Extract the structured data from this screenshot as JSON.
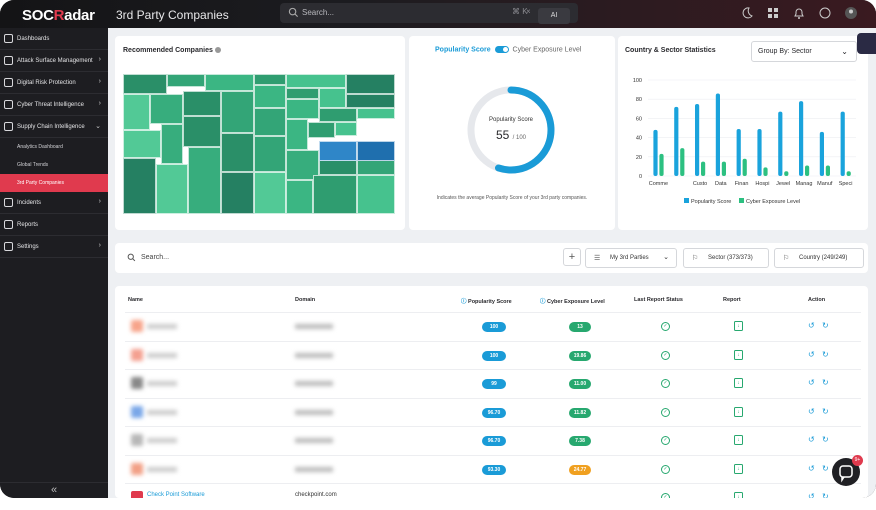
{
  "app": {
    "logo": "SOCRadar",
    "title": "3rd Party Companies"
  },
  "search": {
    "placeholder": "Search...",
    "shortcut": "⌘ K",
    "ai_label": "AI"
  },
  "sidebar": {
    "items": [
      {
        "label": "Dashboards",
        "icon": "dashboard-icon",
        "expandable": false
      },
      {
        "label": "Attack Surface Management",
        "icon": "target-icon",
        "expandable": true
      },
      {
        "label": "Digital Risk Protection",
        "icon": "shield-icon",
        "expandable": true
      },
      {
        "label": "Cyber Threat Intelligence",
        "icon": "radar-icon",
        "expandable": true
      },
      {
        "label": "Supply Chain Intelligence",
        "icon": "chain-icon",
        "expandable": true,
        "expanded": true
      }
    ],
    "subitems": [
      {
        "label": "Analytics Dashboard"
      },
      {
        "label": "Global Trends"
      },
      {
        "label": "3rd Party Companies",
        "active": true
      }
    ],
    "items_after": [
      {
        "label": "Incidents",
        "icon": "alert-icon",
        "expandable": true
      },
      {
        "label": "Reports",
        "icon": "report-icon",
        "expandable": false
      },
      {
        "label": "Settings",
        "icon": "settings-icon",
        "expandable": true
      }
    ],
    "collapse_label": "«"
  },
  "recommended": {
    "title": "Recommended Companies"
  },
  "popularity": {
    "toggle_left": "Popularity Score",
    "toggle_right": "Cyber Exposure Level",
    "label": "Popularity Score",
    "value": "55",
    "max": "/ 100",
    "fraction": 0.55,
    "description": "Indicates the average Popularity Score of your 3rd party companies."
  },
  "stats": {
    "title": "Country & Sector Statistics",
    "group_by": "Group By: Sector"
  },
  "chart_data": {
    "type": "bar",
    "categories": [
      "Comme",
      "",
      "Custo",
      "Data",
      "Finan",
      "Hospi",
      "Jewel",
      "Manag",
      "Manuf",
      "Speci"
    ],
    "series": [
      {
        "name": "Popularity Score",
        "color": "#1aa3dc",
        "values": [
          48,
          72,
          75,
          86,
          49,
          49,
          67,
          78,
          46,
          67
        ]
      },
      {
        "name": "Cyber Exposure Level",
        "color": "#2cc081",
        "values": [
          23,
          29,
          15,
          15,
          18,
          9,
          5,
          11,
          11,
          5
        ]
      }
    ],
    "ylim": [
      0,
      100
    ],
    "yticks": [
      "0",
      "20",
      "40",
      "60",
      "80",
      "100"
    ],
    "legend": "bottom"
  },
  "filters": {
    "search_placeholder": "Search...",
    "my_parties": "My 3rd Parties",
    "sector": "Sector (373/373)",
    "country": "Country (249/249)"
  },
  "table": {
    "headers": {
      "name": "Name",
      "domain": "Domain",
      "popularity": "Popularity Score",
      "exposure": "Cyber Exposure Level",
      "last_report": "Last Report Status",
      "report": "Report",
      "action": "Action"
    },
    "rows": [
      {
        "popularity": "100",
        "exposure": "13",
        "exposure_color": "green"
      },
      {
        "popularity": "100",
        "exposure": "19.86",
        "exposure_color": "green"
      },
      {
        "popularity": "99",
        "exposure": "11.00",
        "exposure_color": "green"
      },
      {
        "popularity": "96.70",
        "exposure": "11.82",
        "exposure_color": "green"
      },
      {
        "popularity": "96.70",
        "exposure": "7.38",
        "exposure_color": "green"
      },
      {
        "popularity": "93.30",
        "exposure": "24.77",
        "exposure_color": "orange"
      },
      {
        "name": "Check Point Software",
        "domain": "checkpoint.com",
        "popularity": "",
        "exposure": "",
        "exposure_color": "green"
      }
    ]
  },
  "chat": {
    "badge": "9+"
  }
}
